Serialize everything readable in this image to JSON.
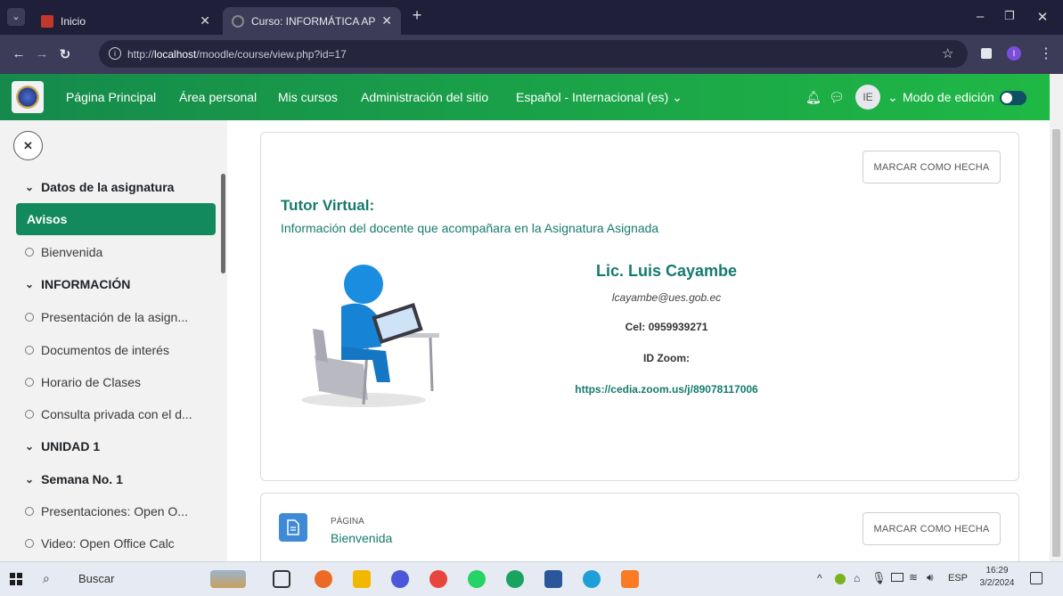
{
  "browser": {
    "tabs": [
      {
        "title": "Inicio",
        "active": false
      },
      {
        "title": "Curso: INFORMÁTICA APLICADA",
        "active": true
      }
    ],
    "url_prefix": "http://",
    "url_host": "localhost",
    "url_path": "/moodle/course/view.php?id=17"
  },
  "topnav": {
    "links": [
      "Página Principal",
      "Área personal",
      "Mis cursos",
      "Administración del sitio",
      "Español - Internacional (es)"
    ],
    "avatar_initials": "IE",
    "edit_mode_label": "Modo de edición"
  },
  "sidebar": {
    "items": [
      {
        "label": "Datos de la asignatura",
        "type": "section"
      },
      {
        "label": "Avisos",
        "type": "active"
      },
      {
        "label": "Bienvenida",
        "type": "item"
      },
      {
        "label": "INFORMACIÓN",
        "type": "section"
      },
      {
        "label": "Presentación de la asign...",
        "type": "item"
      },
      {
        "label": "Documentos de interés",
        "type": "item"
      },
      {
        "label": "Horario de Clases",
        "type": "item"
      },
      {
        "label": "Consulta privada con el d...",
        "type": "item"
      },
      {
        "label": "UNIDAD 1",
        "type": "section"
      },
      {
        "label": "Semana No. 1",
        "type": "section"
      },
      {
        "label": "Presentaciones: Open O...",
        "type": "item"
      },
      {
        "label": "Video: Open Office Calc",
        "type": "item"
      }
    ]
  },
  "main": {
    "mark_done_label": "MARCAR COMO HECHA",
    "tutor_heading": "Tutor Virtual:",
    "tutor_subtitle": "Información del docente que acompañara en la Asignatura Asignada",
    "teacher_name": "Lic. Luis Cayambe",
    "teacher_email": "lcayambe@ues.gob.ec",
    "teacher_phone": "Cel: 0959939271",
    "zoom_label": "ID Zoom:",
    "zoom_link": "https://cedia.zoom.us/j/89078117006",
    "activity_type": "PÁGINA",
    "activity_name": "Bienvenida"
  },
  "taskbar": {
    "search_placeholder": "Buscar",
    "lang": "ESP",
    "time": "16:29",
    "date": "3/2/2024"
  },
  "colors": {
    "topnav_start": "#158a4c",
    "topnav_end": "#1fb845",
    "accent": "#138a5e",
    "teal_text": "#157a6e"
  }
}
